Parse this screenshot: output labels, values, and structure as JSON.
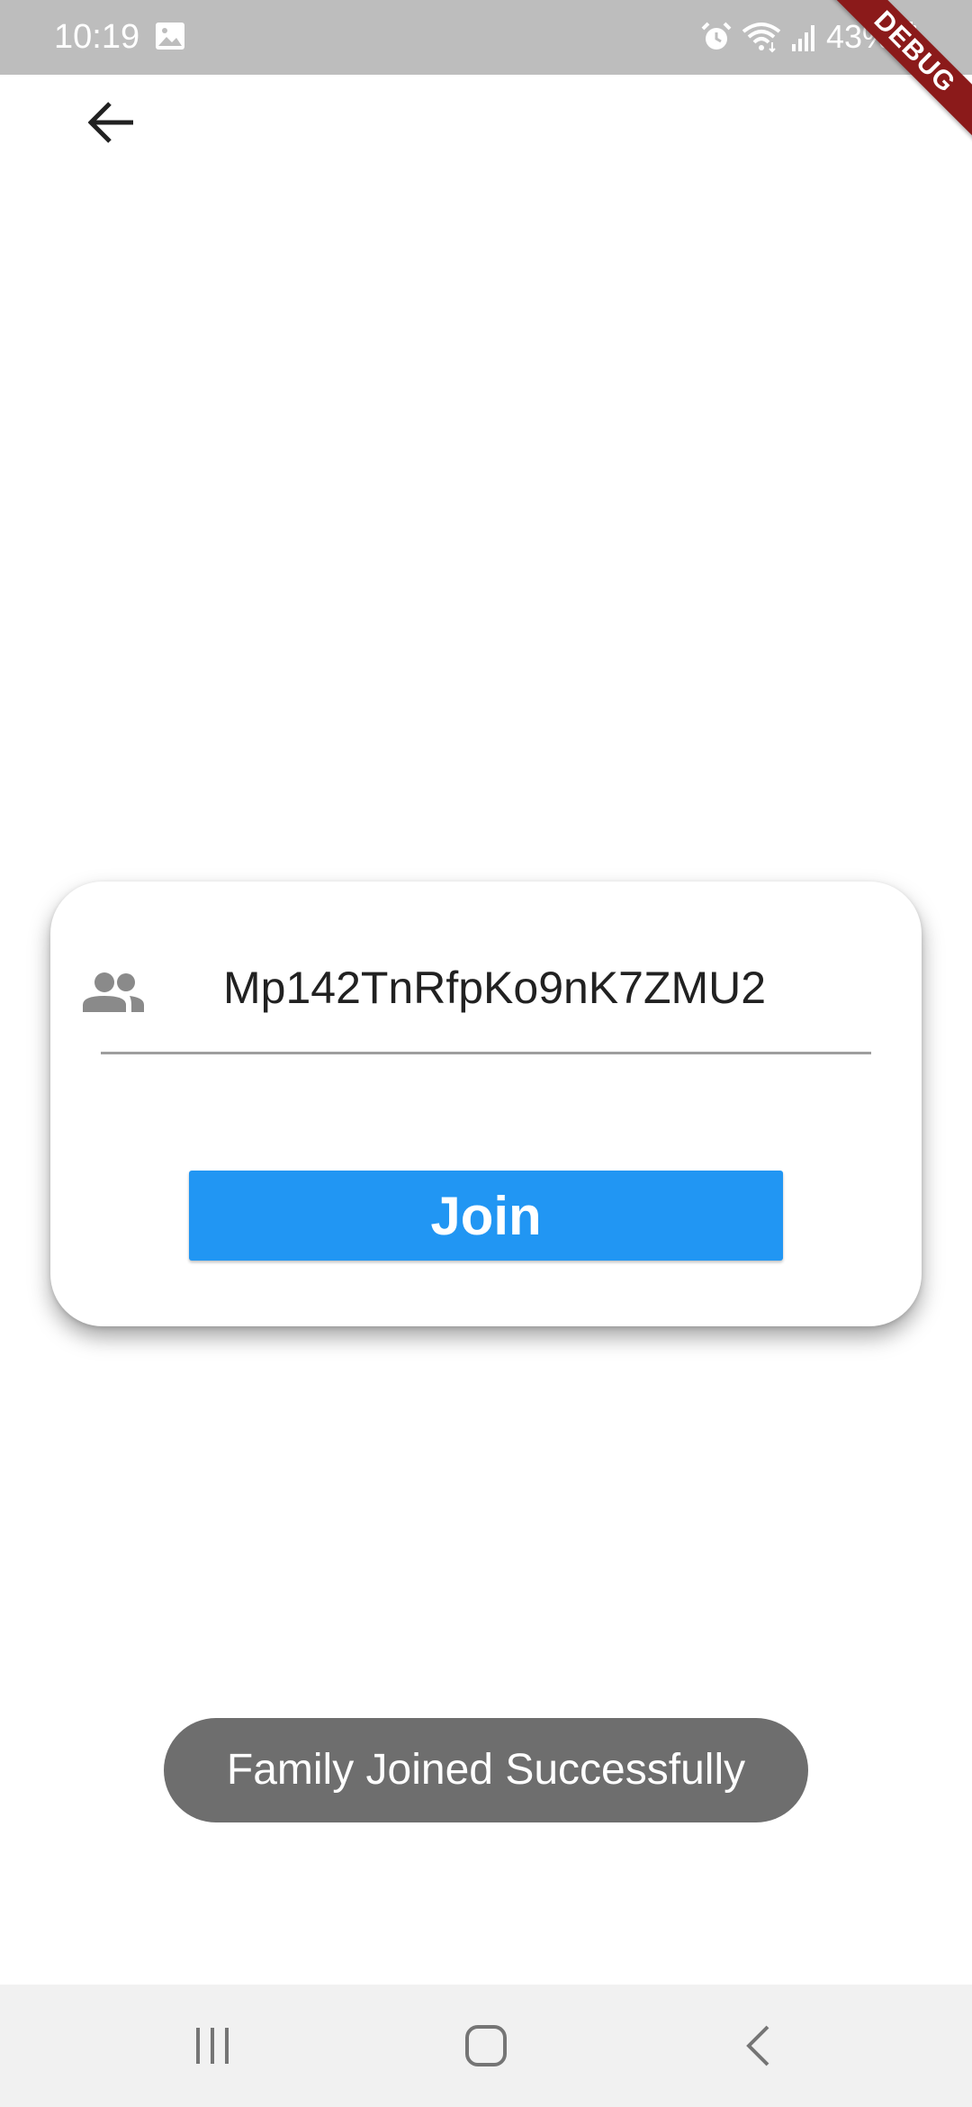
{
  "status_bar": {
    "time": "10:19",
    "battery": "43%",
    "icons": [
      "gallery-icon",
      "alarm-icon",
      "wifi-icon",
      "signal-icon",
      "battery-icon"
    ]
  },
  "debug_banner": {
    "label": "DEBUG",
    "color": "#8b1a1a"
  },
  "app_bar": {
    "back_icon": "arrow-back-icon"
  },
  "join_form": {
    "field_icon": "group-icon",
    "code_value": "Mp142TnRfpKo9nK7ZMU2",
    "join_label": "Join",
    "button_color": "#2196f3"
  },
  "toast": {
    "message": "Family Joined Successfully"
  },
  "nav_bar": {
    "items": [
      "recent-apps-icon",
      "home-icon",
      "back-icon"
    ]
  }
}
